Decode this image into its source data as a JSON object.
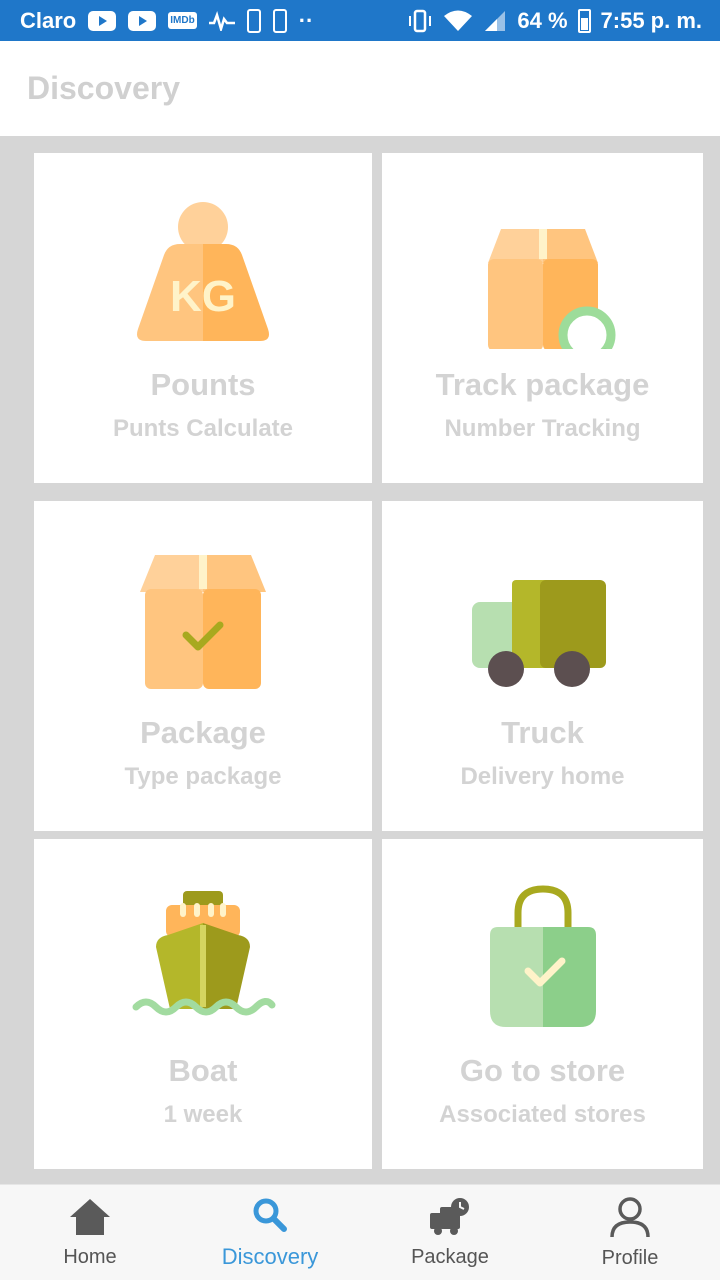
{
  "status_bar": {
    "carrier": "Claro",
    "imdb": "IMDb",
    "dots": "··",
    "battery_percent": "64 %",
    "time": "7:55 p. m."
  },
  "header": {
    "title": "Discovery"
  },
  "cards": [
    {
      "title": "Pounts",
      "subtitle": "Punts Calculate",
      "icon": "kg-weight-icon",
      "icon_text": "KG"
    },
    {
      "title": "Track package",
      "subtitle": "Number Tracking",
      "icon": "package-search-icon"
    },
    {
      "title": "Package",
      "subtitle": "Type package",
      "icon": "package-check-icon"
    },
    {
      "title": "Truck",
      "subtitle": "Delivery home",
      "icon": "truck-icon"
    },
    {
      "title": "Boat",
      "subtitle": "1 week",
      "icon": "boat-icon"
    },
    {
      "title": "Go to store",
      "subtitle": "Associated stores",
      "icon": "shopping-bag-icon"
    }
  ],
  "bottom_nav": {
    "items": [
      {
        "label": "Home",
        "icon": "home-icon"
      },
      {
        "label": "Discovery",
        "icon": "search-icon",
        "active": true
      },
      {
        "label": "Package",
        "icon": "delivery-truck-icon"
      },
      {
        "label": "Profile",
        "icon": "person-icon"
      }
    ]
  },
  "colors": {
    "status_bar": "#1f77c9",
    "accent": "#3a97d9",
    "card_text": "#d3d3d3",
    "orange": "#ffb55a",
    "olive": "#a0a41e",
    "green": "#8ccf8a"
  }
}
